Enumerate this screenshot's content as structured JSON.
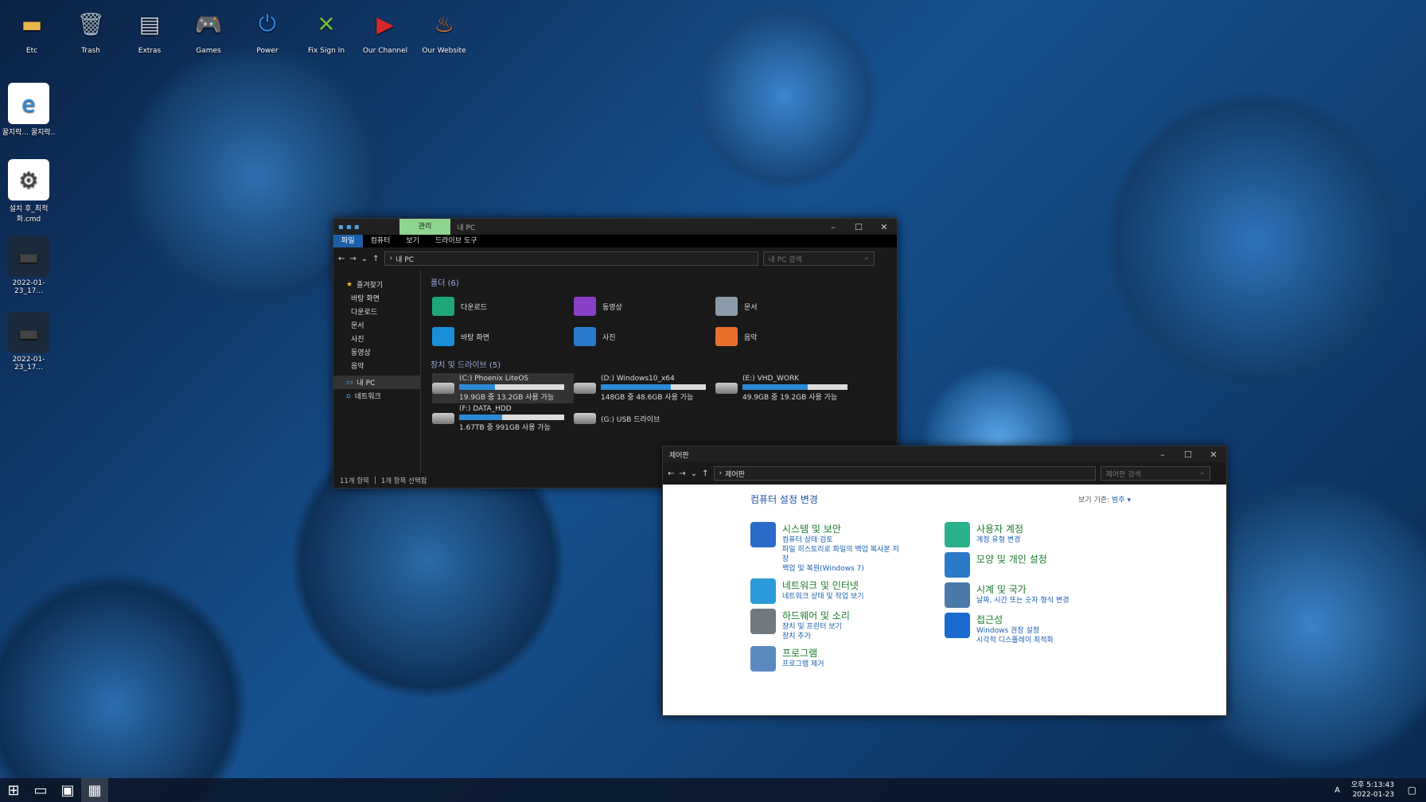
{
  "desktop": {
    "icons": [
      {
        "label": "Etc",
        "icon": "folder-icon",
        "color": "#e8b84a"
      },
      {
        "label": "Trash",
        "icon": "trash-icon",
        "color": "#9fb3c8"
      },
      {
        "label": "Extras",
        "icon": "folders-icon",
        "color": "#c9cdd2"
      },
      {
        "label": "Games",
        "icon": "gamepad-icon",
        "color": "#f0f0f0"
      },
      {
        "label": "Power",
        "icon": "power-icon",
        "color": "#2a8ae8"
      },
      {
        "label": "Fix Sign In",
        "icon": "xbox-icon",
        "color": "#6cbd45"
      },
      {
        "label": "Our Channel",
        "icon": "youtube-icon",
        "color": "#d62828"
      },
      {
        "label": "Our Website",
        "icon": "phoenix-icon",
        "color": "#e87a20"
      }
    ],
    "left_icons": [
      {
        "label": "꿀지락... 꿀지락..",
        "icon": "ie-icon"
      },
      {
        "label": "설치 후_최적화.cmd",
        "icon": "gear-file-icon"
      },
      {
        "label": "2022-01-23_17...",
        "icon": "screenshot-icon"
      },
      {
        "label": "2022-01-23_17...",
        "icon": "screenshot-icon"
      }
    ]
  },
  "explorer": {
    "title": "내 PC",
    "manage_tab": "관리",
    "ribbon": [
      "파일",
      "컴퓨터",
      "보기",
      "드라이브 도구"
    ],
    "path": "내 PC",
    "search_placeholder": "내 PC 검색",
    "nav": {
      "quick": "즐겨찾기",
      "items": [
        "바탕 화면",
        "다운로드",
        "문서",
        "사진",
        "동영상",
        "음악"
      ],
      "thispc": "내 PC",
      "network": "네트워크"
    },
    "folders_header": "폴더 (6)",
    "folders": [
      {
        "name": "다운로드",
        "color": "#1fa67a"
      },
      {
        "name": "동영상",
        "color": "#8a3fc8"
      },
      {
        "name": "문서",
        "color": "#8a9aa8"
      },
      {
        "name": "바탕 화면",
        "color": "#1a8fd8"
      },
      {
        "name": "사진",
        "color": "#2a7ad0"
      },
      {
        "name": "음악",
        "color": "#e8702a"
      }
    ],
    "drives_header": "장치 및 드라이브 (5)",
    "drives": [
      {
        "name": "(C:) Phoenix LiteOS",
        "info": "19.9GB 중 13.2GB 사용 가능",
        "used": 0.34
      },
      {
        "name": "(D:) Windows10_x64",
        "info": "148GB 중 48.6GB 사용 가능",
        "used": 0.67
      },
      {
        "name": "(E:) VHD_WORK",
        "info": "49.9GB 중 19.2GB 사용 가능",
        "used": 0.62
      },
      {
        "name": "(F:) DATA_HDD",
        "info": "1.67TB 중 991GB 사용 가능",
        "used": 0.41
      },
      {
        "name": "(G:) USB 드라이브",
        "info": "",
        "used": null
      }
    ],
    "status": {
      "count": "11개 항목",
      "selected": "1개 항목 선택함"
    }
  },
  "control_panel": {
    "title": "제어판",
    "path": "제어판",
    "search_placeholder": "제어판 검색",
    "heading": "컴퓨터 설정 변경",
    "view_by_label": "보기 기준:",
    "view_by_value": "범주 ▾",
    "left": [
      {
        "title": "시스템 및 보안",
        "links": [
          "컴퓨터 상태 검토",
          "파일 히스토리로 파일의 백업 복사본 저장",
          "백업 및 복원(Windows 7)"
        ],
        "color": "#2a6ac8"
      },
      {
        "title": "네트워크 및 인터넷",
        "links": [
          "네트워크 상태 및 작업 보기"
        ],
        "color": "#2a9ad8"
      },
      {
        "title": "하드웨어 및 소리",
        "links": [
          "장치 및 프린터 보기",
          "장치 추가"
        ],
        "color": "#707880"
      },
      {
        "title": "프로그램",
        "links": [
          "프로그램 제거"
        ],
        "color": "#5a8ac0"
      }
    ],
    "right": [
      {
        "title": "사용자 계정",
        "links": [
          "계정 유형 변경"
        ],
        "color": "#2ab08a"
      },
      {
        "title": "모양 및 개인 설정",
        "links": [],
        "color": "#2a7ac8"
      },
      {
        "title": "시계 및 국가",
        "links": [
          "날짜, 시간 또는 숫자 형식 변경"
        ],
        "color": "#4a7aa8"
      },
      {
        "title": "접근성",
        "links": [
          "Windows 권장 설정",
          "시각적 디스플레이 최적화"
        ],
        "color": "#1a6ad0"
      }
    ]
  },
  "taskbar": {
    "time": "오후 5:13:43",
    "date": "2022-01-23",
    "lang": "A"
  }
}
